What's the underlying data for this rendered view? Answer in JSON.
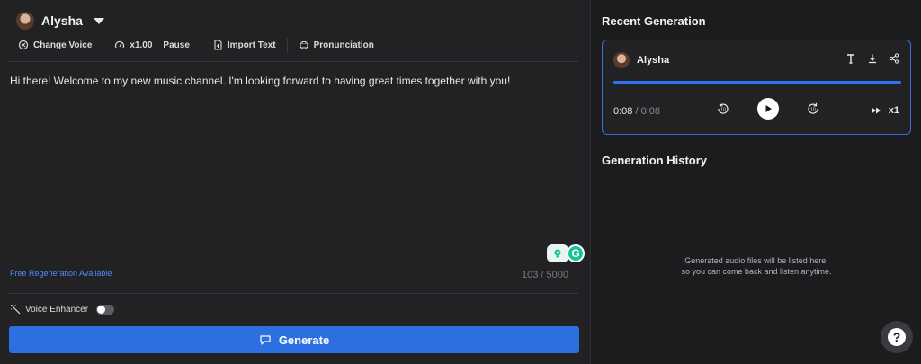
{
  "voice": {
    "name": "Alysha"
  },
  "toolbar": {
    "change_voice": "Change Voice",
    "speed": "x1.00",
    "pause": "Pause",
    "import_text": "Import Text",
    "pronunciation": "Pronunciation"
  },
  "editor": {
    "text": "Hi there! Welcome to my new music channel. I'm looking forward to having great times together with you!",
    "char_count": "103 / 5000",
    "free_regen": "Free Regeneration Available"
  },
  "voice_enhancer": {
    "label": "Voice Enhancer",
    "enabled": false
  },
  "generate_button": {
    "label": "Generate",
    "color": "#2b6fe0"
  },
  "recent": {
    "title": "Recent Generation",
    "voice_name": "Alysha",
    "progress": 1.0,
    "current_time": "0:08",
    "separator": " / ",
    "total_time": "0:08",
    "playback_speed": "x1",
    "accent": "#3a6fd8"
  },
  "history": {
    "title": "Generation History",
    "empty_line1": "Generated audio files will be listed here,",
    "empty_line2": "so you can come back and listen anytime."
  },
  "help": {
    "icon": "?"
  }
}
